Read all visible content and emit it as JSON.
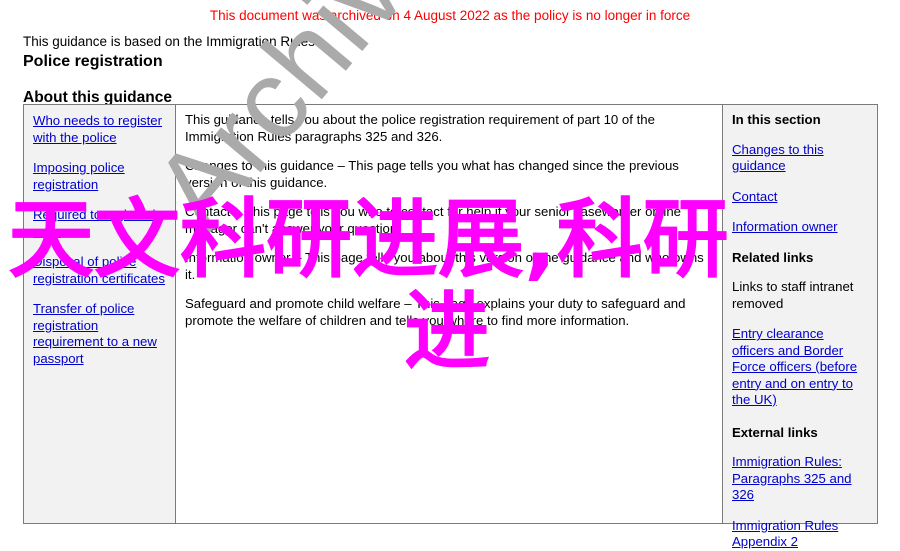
{
  "archive_notice": "This document was archived on 4 August 2022 as the policy is no longer in force",
  "header": {
    "intro_line": "This guidance is based on the Immigration Rules",
    "document_title": "Police registration",
    "section_heading": "About this guidance"
  },
  "nav_column": {
    "links": [
      "Who needs to register with the police",
      "Imposing police registration",
      "Required to register in error",
      "Disposal of police registration certificates",
      "Transfer of police registration requirement to a new passport"
    ]
  },
  "main_column": {
    "paragraphs": [
      "This guidance tells you about the police registration requirement of part 10 of the Immigration Rules paragraphs 325 and 326.",
      "Changes to this guidance – This page tells you what has changed since the previous version of this guidance.",
      "Contact – This page tells you who to contact for help if your senior caseworker or line manager can't answer your question.",
      "Information owner – This page tells you about this version of the guidance and who owns it.",
      "Safeguard and promote child welfare – This page explains your duty to safeguard and promote the welfare of children and tells you where to find more information."
    ]
  },
  "side_column": {
    "in_this_section_heading": "In this section",
    "in_this_section_links": [
      "Changes to this guidance",
      "Contact",
      "Information owner"
    ],
    "related_links_heading": "Related links",
    "related_links_note": "Links to staff intranet removed",
    "related_links": [
      "Entry clearance officers and Border Force officers (before entry and on entry to the UK)"
    ],
    "external_links_heading": "External links",
    "external_links": [
      "Immigration Rules: Paragraphs 325 and 326",
      "Immigration Rules Appendix 2"
    ]
  },
  "watermarks": {
    "archived_text": "Archived",
    "archived_color": "#aaaaaa",
    "overlay_line1": "天文科研进展,科研",
    "overlay_line2": "进",
    "overlay_color": "#ff00ff"
  },
  "colors": {
    "archive_notice": "#ff0000",
    "link": "#0000cc",
    "panel_background": "#f2f2f2",
    "border": "#7a7a7a"
  }
}
